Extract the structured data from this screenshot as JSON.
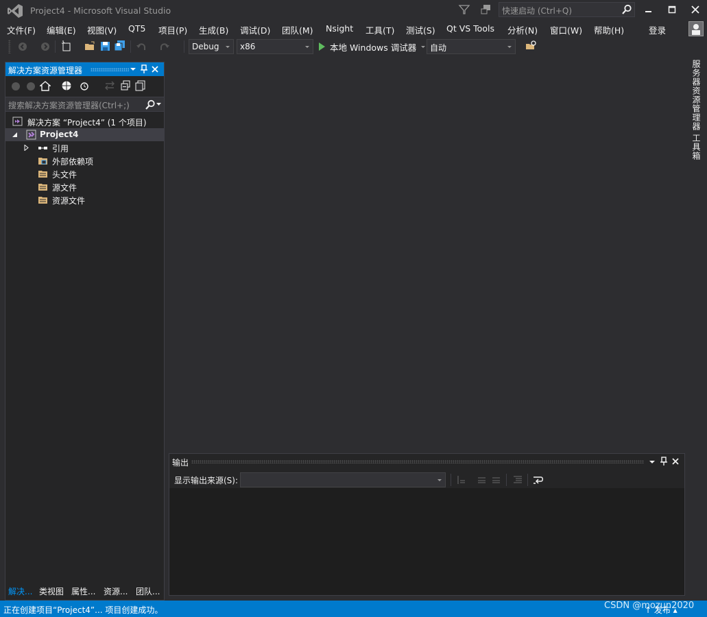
{
  "window": {
    "title": "Project4 - Microsoft Visual Studio",
    "quick_launch_placeholder": "快速启动 (Ctrl+Q)"
  },
  "menu": [
    "文件(F)",
    "编辑(E)",
    "视图(V)",
    "QT5",
    "项目(P)",
    "生成(B)",
    "调试(D)",
    "团队(M)",
    "Nsight",
    "工具(T)",
    "测试(S)",
    "Qt VS Tools",
    "分析(N)",
    "窗口(W)",
    "帮助(H)"
  ],
  "account": {
    "login": "登录"
  },
  "toolbar": {
    "config": "Debug",
    "platform": "x86",
    "run_label": "本地 Windows 调试器",
    "run_mode": "自动"
  },
  "solution_explorer": {
    "title": "解决方案资源管理器",
    "search_placeholder": "搜索解决方案资源管理器(Ctrl+;)",
    "tree": [
      {
        "label": "解决方案 “Project4” (1 个项目)",
        "icon": "solution-icon"
      },
      {
        "label": "Project4",
        "icon": "project-icon"
      },
      {
        "label": "引用",
        "icon": "references-icon"
      },
      {
        "label": "外部依赖项",
        "icon": "external-deps-icon"
      },
      {
        "label": "头文件",
        "icon": "folder-icon"
      },
      {
        "label": "源文件",
        "icon": "folder-icon"
      },
      {
        "label": "资源文件",
        "icon": "folder-icon"
      }
    ],
    "tabs": [
      "解决...",
      "类视图",
      "属性...",
      "资源...",
      "团队..."
    ]
  },
  "right_strip": {
    "server_explorer": "服务器资源管理器",
    "toolbox": "工具箱"
  },
  "output": {
    "title": "输出",
    "source_label": "显示输出来源(S):",
    "source_value": ""
  },
  "status": {
    "text": "正在创建项目“Project4”... 项目创建成功。",
    "right": "↑ 发布 ▴"
  },
  "watermark": "CSDN @mozun2020",
  "colors": {
    "accent": "#007acc",
    "background": "#2d2d30",
    "panel": "#252526",
    "run_green": "#5fbc5f"
  }
}
